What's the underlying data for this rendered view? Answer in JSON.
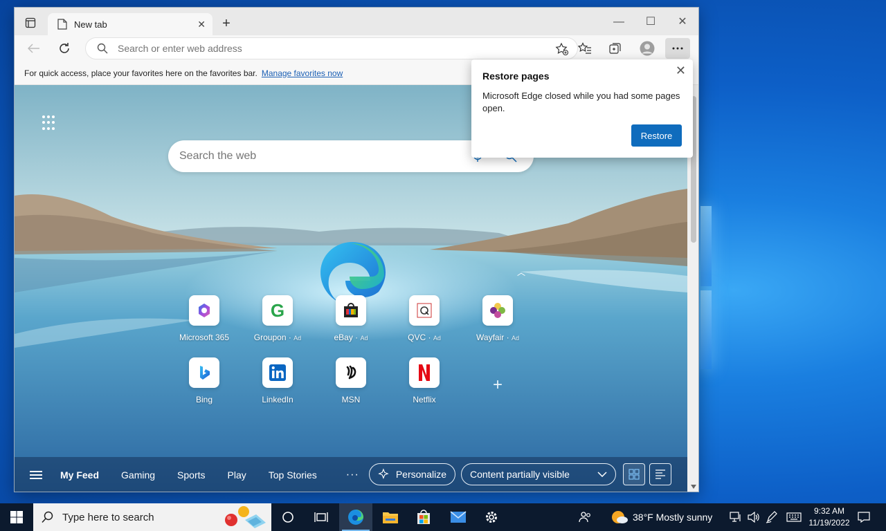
{
  "browser": {
    "tab_title": "New tab",
    "address_placeholder": "Search or enter web address",
    "favbar_text": "For quick access, place your favorites here on the favorites bar.",
    "favbar_link": "Manage favorites now"
  },
  "newtab": {
    "search_placeholder": "Search the web",
    "tiles": [
      {
        "label": "Microsoft 365",
        "ad": "",
        "icon": "microsoft-365-icon"
      },
      {
        "label": "Groupon",
        "ad": "Ad",
        "icon": "groupon-icon"
      },
      {
        "label": "eBay",
        "ad": "Ad",
        "icon": "ebay-icon"
      },
      {
        "label": "QVC",
        "ad": "Ad",
        "icon": "qvc-icon"
      },
      {
        "label": "Wayfair",
        "ad": "Ad",
        "icon": "wayfair-icon"
      },
      {
        "label": "Bing",
        "ad": "",
        "icon": "bing-icon"
      },
      {
        "label": "LinkedIn",
        "ad": "",
        "icon": "linkedin-icon"
      },
      {
        "label": "MSN",
        "ad": "",
        "icon": "msn-icon"
      },
      {
        "label": "Netflix",
        "ad": "",
        "icon": "netflix-icon"
      }
    ],
    "feed": {
      "tabs": [
        "My Feed",
        "Gaming",
        "Sports",
        "Play",
        "Top Stories"
      ],
      "more": "···",
      "personalize": "Personalize",
      "content_select": "Content partially visible"
    }
  },
  "popup": {
    "title": "Restore pages",
    "message": "Microsoft Edge closed while you had some pages open.",
    "button": "Restore"
  },
  "taskbar": {
    "search_placeholder": "Type here to search",
    "weather": "38°F  Mostly sunny",
    "time": "9:32 AM",
    "date": "11/19/2022"
  },
  "colors": {
    "accent": "#0f6cbd",
    "taskbar": "#0c1a2e"
  }
}
